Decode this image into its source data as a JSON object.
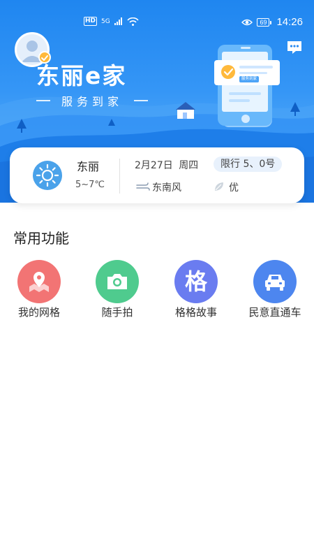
{
  "status_bar": {
    "hd": "HD",
    "network": "5G",
    "battery": "69",
    "time": "14:26"
  },
  "header": {
    "brand_title": "东丽e家",
    "brand_subtitle": "服务到家",
    "illustration_tag": "服务到家"
  },
  "weather": {
    "city": "东丽",
    "temperature": "5~7℃",
    "date": "2月27日",
    "weekday": "周四",
    "traffic_limit": "限行 5、0号",
    "wind": "东南风",
    "air_quality": "优"
  },
  "functions": {
    "title": "常用功能",
    "items": [
      {
        "label": "我的网格",
        "icon": "map-pin-icon",
        "color": "#f27474"
      },
      {
        "label": "随手拍",
        "icon": "camera-icon",
        "color": "#4fcb8e"
      },
      {
        "label": "格格故事",
        "icon": "ge-character-icon",
        "glyph": "格",
        "color": "#6a7cf0"
      },
      {
        "label": "民意直通车",
        "icon": "car-icon",
        "color": "#4d86ef"
      }
    ]
  },
  "colors": {
    "hero_blue": "#1f86f0",
    "badge_orange": "#ffb93b",
    "limit_pill": "#e8f1fc"
  }
}
